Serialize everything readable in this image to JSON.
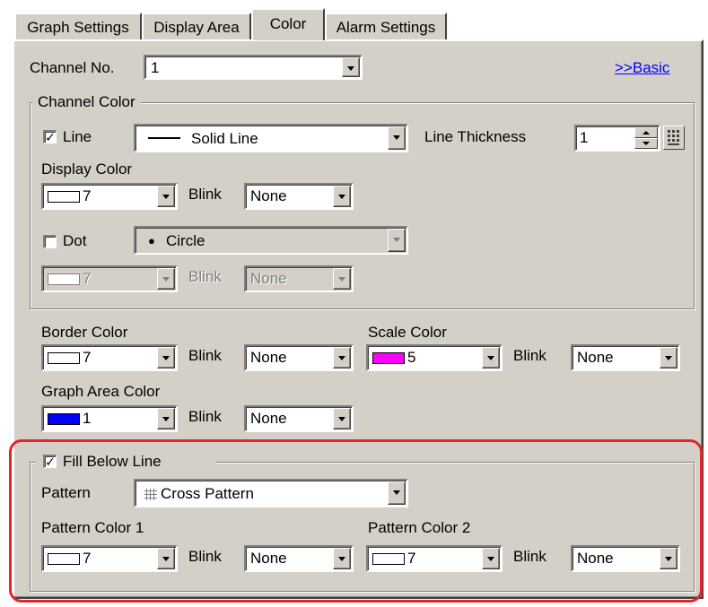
{
  "tabs": [
    "Graph Settings",
    "Display Area",
    "Color",
    "Alarm Settings"
  ],
  "channel": {
    "label": "Channel No.",
    "value": "1",
    "basic_link": ">>Basic"
  },
  "channel_color": {
    "title": "Channel Color",
    "line": {
      "checked": true,
      "label": "Line",
      "style": "Solid Line"
    },
    "line_thickness": {
      "label": "Line Thickness",
      "value": "1"
    },
    "display_color": {
      "label": "Display Color",
      "color_value": "7",
      "swatch": "#ffffff",
      "blink_label": "Blink",
      "blink_value": "None"
    },
    "dot": {
      "checked": false,
      "label": "Dot",
      "style": "Circle"
    },
    "dot_color": {
      "color_value": "7",
      "swatch": "#ffffff",
      "blink_label": "Blink",
      "blink_value": "None"
    }
  },
  "border_color": {
    "label": "Border Color",
    "color_value": "7",
    "swatch": "#ffffff",
    "blink_label": "Blink",
    "blink_value": "None"
  },
  "scale_color": {
    "label": "Scale Color",
    "color_value": "5",
    "swatch": "#ff00ff",
    "blink_label": "Blink",
    "blink_value": "None"
  },
  "graph_area_color": {
    "label": "Graph Area Color",
    "color_value": "1",
    "swatch": "#0000ff",
    "blink_label": "Blink",
    "blink_value": "None"
  },
  "fill": {
    "checked": true,
    "label": "Fill Below Line",
    "pattern_label": "Pattern",
    "pattern_value": "Cross Pattern",
    "color1": {
      "label": "Pattern Color 1",
      "color_value": "7",
      "swatch": "#ffffff",
      "blink_label": "Blink",
      "blink_value": "None"
    },
    "color2": {
      "label": "Pattern Color 2",
      "color_value": "7",
      "swatch": "#ffffff",
      "blink_label": "Blink",
      "blink_value": "None"
    }
  },
  "glyphs": {
    "check": "✓",
    "dot": "●"
  },
  "colors": {
    "highlight": "#e8232c",
    "face": "#d4d0c8",
    "link": "#0000ff"
  }
}
